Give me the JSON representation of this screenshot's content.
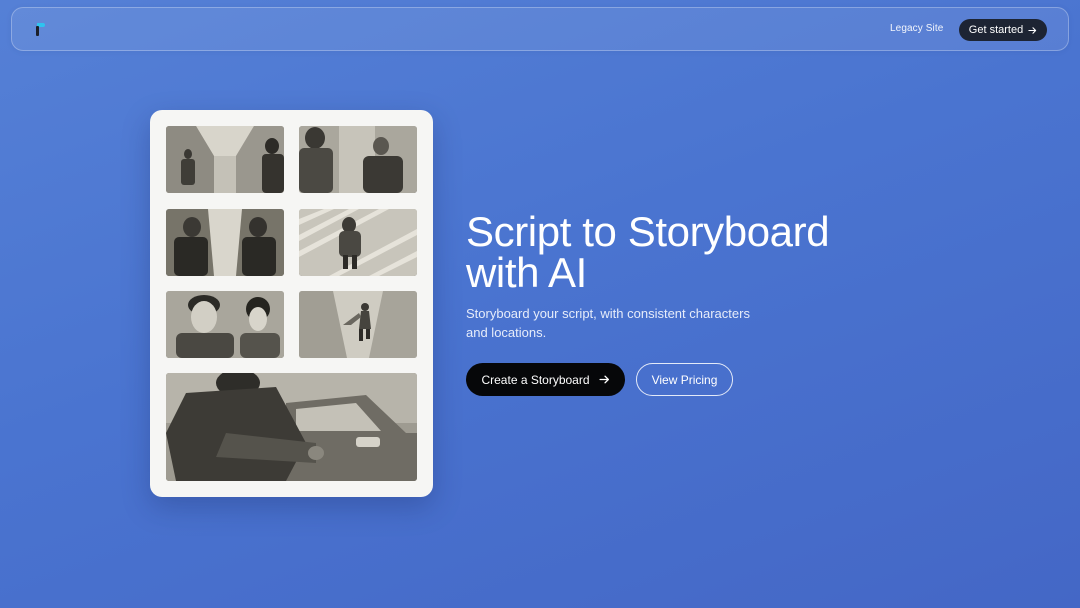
{
  "nav": {
    "logo_icon": "brand-logo-icon",
    "legacy_label": "Legacy Site",
    "cta_label": "Get started",
    "cta_icon": "arrow-right-icon"
  },
  "storyboard": {
    "panels": [
      "corridor-two-figures",
      "street-two-figures",
      "hallway-face-off",
      "overhead-crosswalk-figure",
      "close-up-man-and-woman",
      "running-figure-street",
      "man-entering-car"
    ]
  },
  "hero": {
    "title": "Script to Storyboard with AI",
    "subtitle": "Storyboard your script, with consistent characters and locations.",
    "primary_cta": "Create a Storyboard",
    "primary_icon": "arrow-right-icon",
    "secondary_cta": "View Pricing"
  },
  "colors": {
    "background": "#4a74d0",
    "primary_button": "#060709",
    "nav_button": "#1d2433",
    "logo_accent": "#2ec3ef"
  }
}
